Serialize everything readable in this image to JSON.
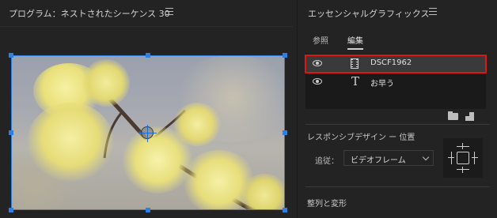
{
  "program": {
    "title": "プログラム：ネストされたシーケンス 30",
    "menu_icon": "hamburger-icon"
  },
  "essential_graphics": {
    "title": "エッセンシャルグラフィックス",
    "menu_icon": "hamburger-icon",
    "tabs": [
      {
        "label": "参照",
        "active": false
      },
      {
        "label": "編集",
        "active": true
      }
    ],
    "layers": [
      {
        "name": "DSCF1962",
        "icon": "film-clip-icon",
        "visible": true,
        "selected": true
      },
      {
        "name": "お早う",
        "icon": "text-icon",
        "visible": true,
        "selected": false
      }
    ],
    "responsive_design": {
      "section_title": "レスポンシブデザイン ー 位置",
      "follow_label": "追従：",
      "follow_value": "ビデオフレーム"
    },
    "align_transform": {
      "section_title": "整列と変形"
    }
  },
  "colors": {
    "selection_box": "#2f7fe0",
    "highlight_outline": "#e01515",
    "panel_bg": "#232323"
  }
}
